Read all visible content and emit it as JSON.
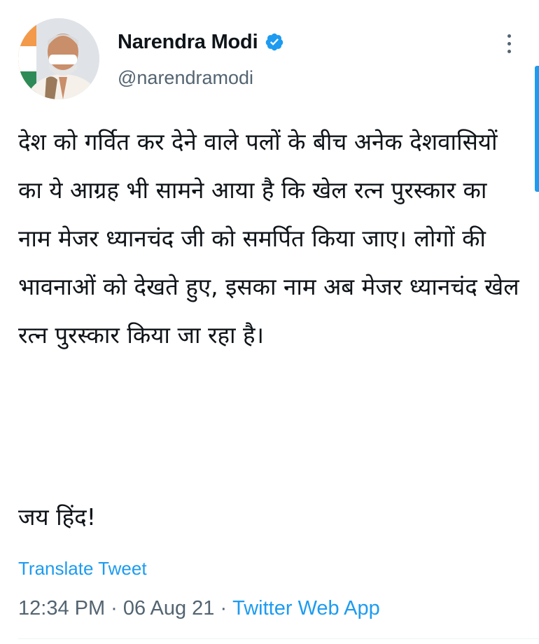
{
  "author": {
    "display_name": "Narendra Modi",
    "handle": "@narendramodi",
    "verified_icon": "verified-badge-icon",
    "avatar_icon": "profile-avatar"
  },
  "tweet": {
    "body": "देश को गर्वित कर देने वाले पलों के बीच अनेक देशवासियों का ये आग्रह भी सामने आया है कि खेल रत्न पुरस्कार का नाम मेजर ध्यानचंद जी को समर्पित किया जाए। लोगों की भावनाओं को देखते हुए, इसका नाम अब मेजर ध्यानचंद खेल रत्न पुरस्कार किया जा रहा है।",
    "signoff": "जय हिंद!",
    "translate_label": "Translate Tweet",
    "time": "12:34 PM",
    "date": "06 Aug 21",
    "separator": "·",
    "source": "Twitter Web App"
  },
  "colors": {
    "accent": "#1d9bf0",
    "secondary_text": "#536471",
    "primary_text": "#0f1419"
  }
}
